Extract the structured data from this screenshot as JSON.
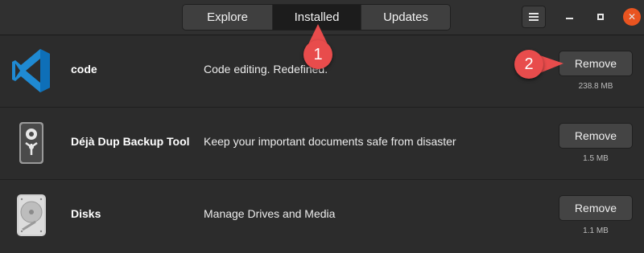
{
  "header": {
    "tabs": [
      {
        "label": "Explore"
      },
      {
        "label": "Installed",
        "active": true
      },
      {
        "label": "Updates"
      }
    ],
    "menu_icon": "hamburger-menu-icon",
    "window_controls": [
      "minimize-icon",
      "maximize-icon",
      "close-icon"
    ],
    "close_glyph": "✕"
  },
  "apps": [
    {
      "name": "code",
      "summary": "Code editing. Redefined.",
      "remove_label": "Remove",
      "size": "238.8 MB",
      "icon": "vscode-icon"
    },
    {
      "name": "Déjà Dup Backup Tool",
      "summary": "Keep your important documents safe from disaster",
      "remove_label": "Remove",
      "size": "1.5 MB",
      "icon": "deja-dup-icon"
    },
    {
      "name": "Disks",
      "summary": "Manage Drives and Media",
      "remove_label": "Remove",
      "size": "1.1 MB",
      "icon": "disks-icon"
    }
  ],
  "annotations": [
    {
      "number": "1"
    },
    {
      "number": "2"
    }
  ],
  "colors": {
    "accent_close": "#e95420",
    "callout": "#e84c4c",
    "background": "#2c2c2c",
    "vscode_blue": "#1f8ad2"
  }
}
